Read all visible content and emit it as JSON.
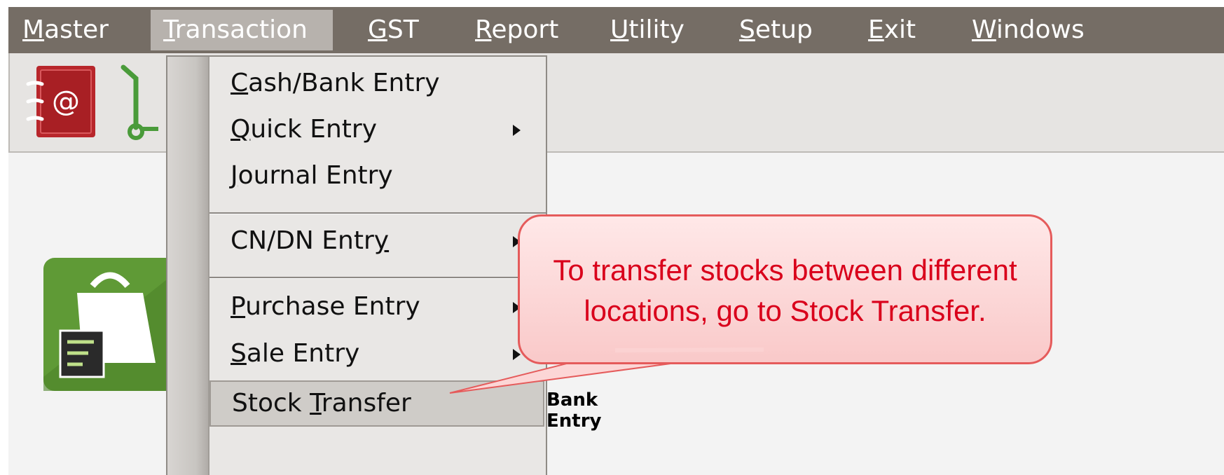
{
  "menubar": {
    "items": [
      {
        "label": "Master",
        "key": "M"
      },
      {
        "label": "Transaction",
        "key": "T"
      },
      {
        "label": "GST",
        "key": "G"
      },
      {
        "label": "Report",
        "key": "R"
      },
      {
        "label": "Utility",
        "key": "U"
      },
      {
        "label": "Setup",
        "key": "S"
      },
      {
        "label": "Exit",
        "key": "E"
      },
      {
        "label": "Windows",
        "key": "W"
      }
    ],
    "active": "Transaction"
  },
  "toolbar": {
    "icons": [
      "address-book-icon",
      "trolley-icon"
    ]
  },
  "dropdown": {
    "items": [
      {
        "label": "Cash/Bank Entry",
        "submenu": false
      },
      {
        "label": "Quick Entry",
        "submenu": true
      },
      {
        "label": "Journal Entry",
        "submenu": false
      },
      {
        "label": "CN/DN Entry",
        "submenu": true
      },
      {
        "label": "Purchase Entry",
        "submenu": true
      },
      {
        "label": "Sale Entry",
        "submenu": true
      },
      {
        "label": "Stock Transfer",
        "submenu": false,
        "selected": true
      }
    ]
  },
  "desktop": {
    "tiles": [
      {
        "name": "purchase-tile",
        "icon": "shopping-bag-icon"
      },
      {
        "name": "bank-entry-tile",
        "icon": "bank-icon",
        "label_lines": [
          "Bank",
          "Entry"
        ]
      }
    ]
  },
  "callout": {
    "line1": "To transfer stocks between different",
    "line2": "locations, go to Stock Transfer."
  },
  "colors": {
    "menubar_bg": "#756d65",
    "menu_active_bg": "#b7b2ad",
    "callout_text": "#d9001b",
    "callout_border": "#e55b5b",
    "callout_fill": "#fcd9d9",
    "tile_green": "#5f9a36",
    "tile_teal": "#0f8a6e"
  }
}
